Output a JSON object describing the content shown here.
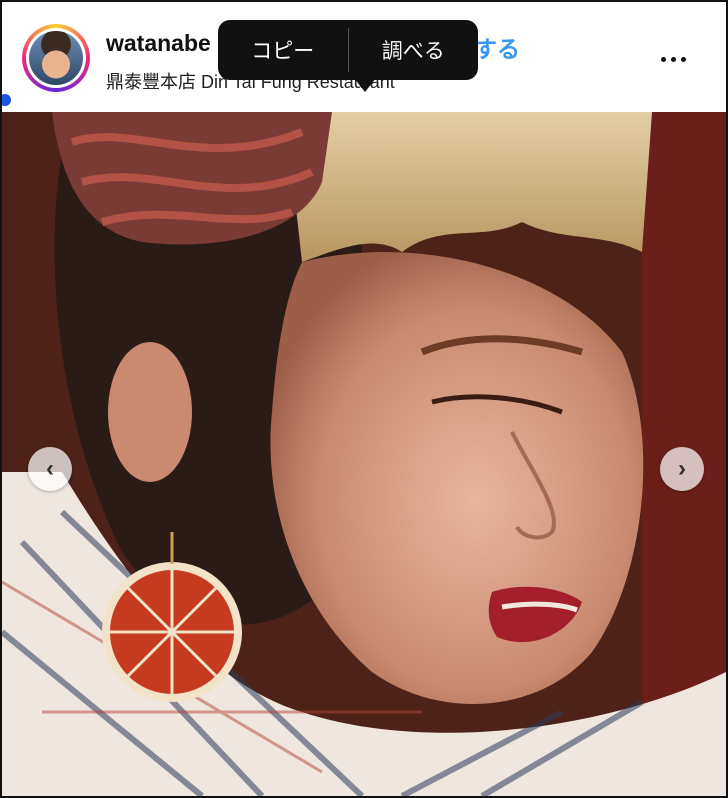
{
  "post": {
    "username": "watanabe",
    "follow_label": "する",
    "location": "鼎泰豐本店 Din Tai Fung Restaurant"
  },
  "context_menu": {
    "copy_label": "コピー",
    "lookup_label": "調べる"
  },
  "carousel": {
    "prev_icon": "chevron-left-icon",
    "next_icon": "chevron-right-icon",
    "prev_glyph": "‹",
    "next_glyph": "›"
  },
  "colors": {
    "follow_blue": "#3897f0",
    "menu_bg": "#111111"
  }
}
